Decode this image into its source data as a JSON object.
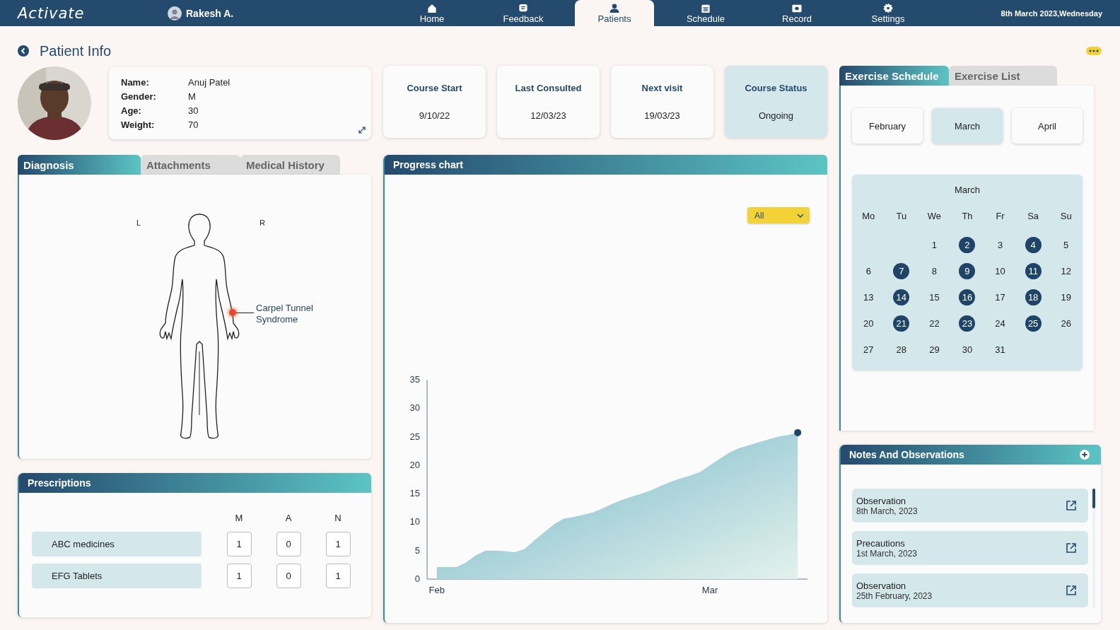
{
  "app": {
    "logo": "Activate",
    "user": "Rakesh A.",
    "date": "8th March 2023,Wednesday"
  },
  "nav": [
    {
      "label": "Home",
      "kind": "home",
      "selected": false
    },
    {
      "label": "Feedback",
      "kind": "feedback",
      "selected": false
    },
    {
      "label": "Patients",
      "kind": "patients",
      "selected": true
    },
    {
      "label": "Schedule",
      "kind": "schedule",
      "selected": false
    },
    {
      "label": "Record",
      "kind": "record",
      "selected": false
    },
    {
      "label": "Settings",
      "kind": "settings",
      "selected": false
    }
  ],
  "page": {
    "title": "Patient Info"
  },
  "patient": {
    "fields": [
      {
        "label": "Name:",
        "value": "Anuj Patel"
      },
      {
        "label": "Gender:",
        "value": "M"
      },
      {
        "label": "Age:",
        "value": "30"
      },
      {
        "label": "Weight:",
        "value": "70"
      }
    ]
  },
  "stats": [
    {
      "label": "Course Start",
      "value": "9/10/22",
      "kind": "date"
    },
    {
      "label": "Last Consulted",
      "value": "12/03/23",
      "kind": "date"
    },
    {
      "label": "Next visit",
      "value": "19/03/23",
      "kind": "date"
    },
    {
      "label": "Course Status",
      "value": "Ongoing",
      "kind": "status"
    }
  ],
  "diagnosis": {
    "tabs": [
      {
        "label": "Diagnosis",
        "selected": true
      },
      {
        "label": "Attachments",
        "selected": false
      },
      {
        "label": "Medical History",
        "selected": false
      }
    ],
    "left_label": "L",
    "right_label": "R",
    "condition": "Carpel Tunnel\nSyndrome"
  },
  "prescriptions": {
    "title": "Prescriptions",
    "columns": [
      "M",
      "A",
      "N"
    ],
    "rows": [
      {
        "name": "ABC medicines",
        "doses": [
          "1",
          "0",
          "1"
        ]
      },
      {
        "name": "EFG Tablets",
        "doses": [
          "1",
          "0",
          "1"
        ]
      }
    ]
  },
  "progress": {
    "title": "Progress chart",
    "filter": "All",
    "chart_data": {
      "type": "area",
      "categories": [
        "Feb",
        null,
        null,
        null,
        null,
        null,
        null,
        null,
        null,
        null,
        null,
        null,
        null,
        null,
        null,
        null,
        null,
        null,
        null,
        null,
        null,
        null,
        null,
        null,
        null,
        null,
        null,
        null,
        "Mar",
        null,
        null,
        null,
        null,
        null,
        null,
        null,
        null,
        null
      ],
      "series": [
        {
          "color": "#6fb3c8",
          "values": [
            2.1,
            2.1,
            2.1,
            2.9,
            4.2,
            5,
            5,
            4.9,
            4.7,
            5.3,
            6.8,
            8.2,
            9.6,
            10.6,
            10.9,
            11.3,
            11.7,
            12.4,
            13.2,
            13.9,
            14.5,
            15,
            15.6,
            16.4,
            17.1,
            17.7,
            18.2,
            18.8,
            20,
            21.1,
            22.2,
            23,
            23.5,
            24,
            24.5,
            25,
            25.3,
            25.7
          ]
        }
      ],
      "ylim": [
        0,
        35
      ],
      "yticks": [
        0,
        5,
        10,
        15,
        20,
        25,
        30,
        35
      ]
    }
  },
  "exercise": {
    "tabs": [
      {
        "label": "Exercise Schedule",
        "selected": true
      },
      {
        "label": "Exercise List",
        "selected": false
      }
    ],
    "months": [
      {
        "label": "February",
        "selected": false
      },
      {
        "label": "March",
        "selected": true
      },
      {
        "label": "April",
        "selected": false
      }
    ],
    "calendar": {
      "title": "March",
      "weekdays": [
        "Mo",
        "Tu",
        "We",
        "Th",
        "Fr",
        "Sa",
        "Su"
      ],
      "weeks": [
        {
          "days": [
            {
              "label": "1",
              "highlighted": false
            },
            {
              "label": "2",
              "highlighted": true
            },
            {
              "label": "3",
              "highlighted": false
            },
            {
              "label": "4",
              "highlighted": true
            },
            {
              "label": "5",
              "highlighted": false
            }
          ]
        },
        {
          "days": [
            {
              "label": "6",
              "highlighted": false
            },
            {
              "label": "7",
              "highlighted": true
            },
            {
              "label": "8",
              "highlighted": false
            },
            {
              "label": "9",
              "highlighted": true
            },
            {
              "label": "10",
              "highlighted": false
            },
            {
              "label": "11",
              "highlighted": true
            },
            {
              "label": "12",
              "highlighted": false
            }
          ]
        },
        {
          "days": [
            {
              "label": "13",
              "highlighted": false
            },
            {
              "label": "14",
              "highlighted": true
            },
            {
              "label": "15",
              "highlighted": false
            },
            {
              "label": "16",
              "highlighted": true
            },
            {
              "label": "17",
              "highlighted": false
            },
            {
              "label": "18",
              "highlighted": true
            },
            {
              "label": "19",
              "highlighted": false
            }
          ]
        },
        {
          "days": [
            {
              "label": "20",
              "highlighted": false
            },
            {
              "label": "21",
              "highlighted": true
            },
            {
              "label": "22",
              "highlighted": false
            },
            {
              "label": "23",
              "highlighted": true
            },
            {
              "label": "24",
              "highlighted": false
            },
            {
              "label": "25",
              "highlighted": true
            },
            {
              "label": "26",
              "highlighted": false
            }
          ]
        },
        {
          "days": [
            {
              "label": "27",
              "highlighted": false
            },
            {
              "label": "28",
              "highlighted": false
            },
            {
              "label": "29",
              "highlighted": false
            },
            {
              "label": "30",
              "highlighted": false
            },
            {
              "label": "31",
              "highlighted": false
            }
          ]
        }
      ]
    }
  },
  "notes": {
    "title": "Notes And Observations",
    "items": [
      {
        "title": "Observation",
        "date": "8th March, 2023"
      },
      {
        "title": "Precautions",
        "date": "1st March, 2023"
      },
      {
        "title": "Observation",
        "date": "25th February, 2023"
      }
    ]
  }
}
